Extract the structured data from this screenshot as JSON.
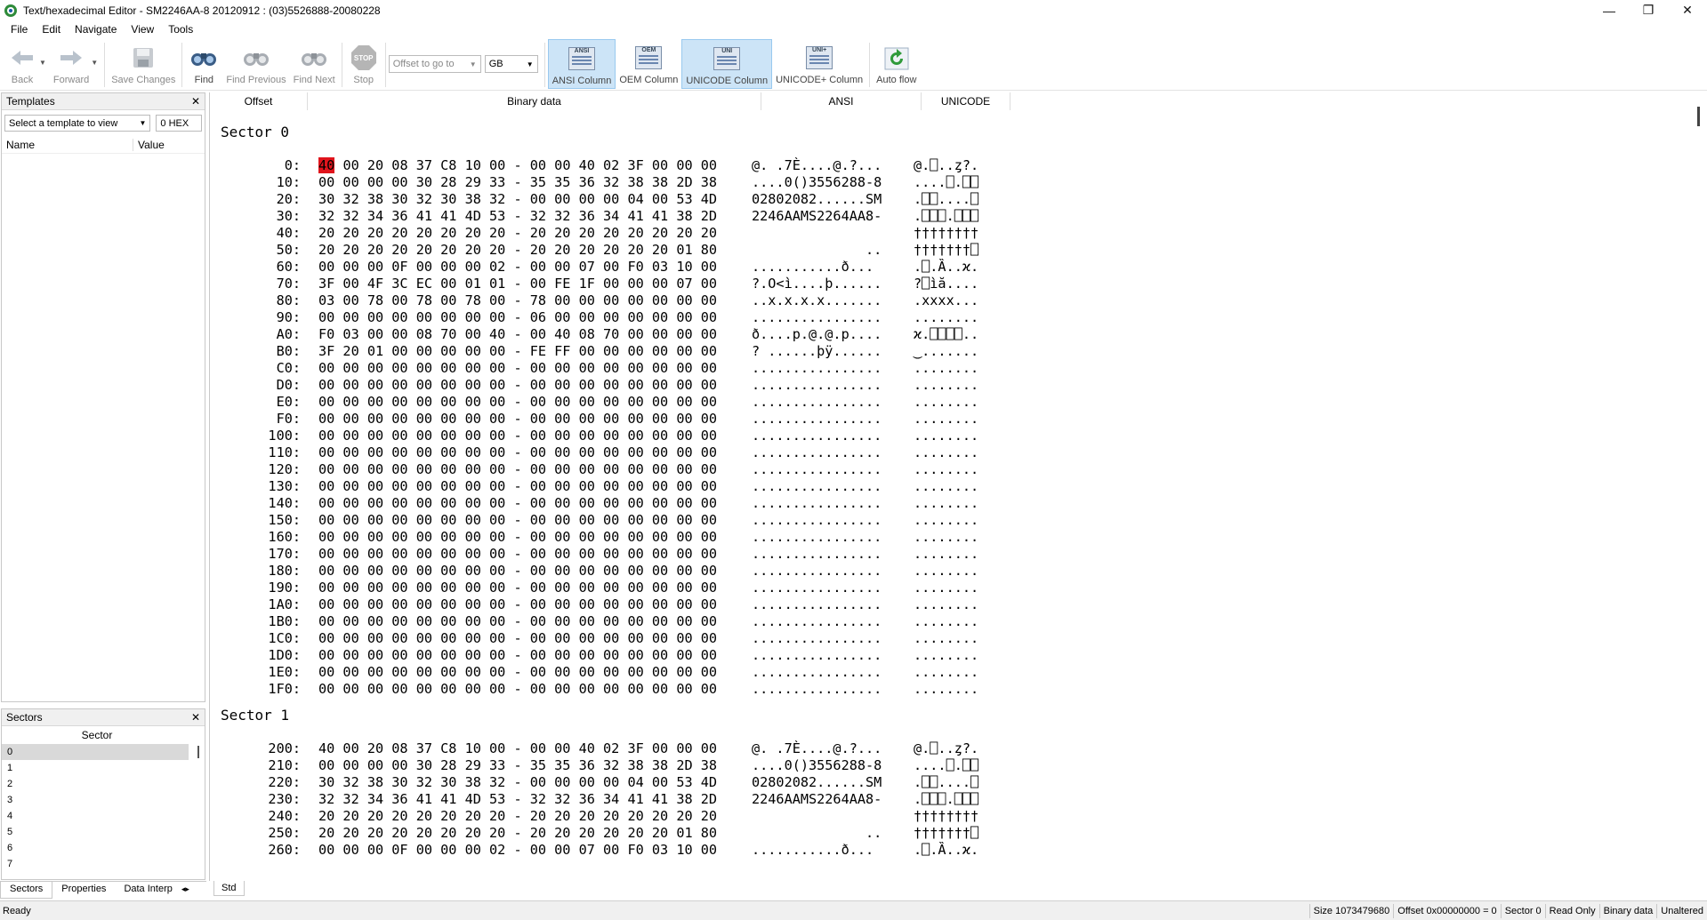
{
  "window": {
    "title": "Text/hexadecimal Editor - SM2246AA-8 20120912 : (03)5526888-20080228",
    "controls": [
      "—",
      "❐",
      "✕"
    ]
  },
  "menu": [
    "File",
    "Edit",
    "Navigate",
    "View",
    "Tools"
  ],
  "toolbar": {
    "back": "Back",
    "forward": "Forward",
    "save": "Save Changes",
    "find": "Find",
    "find_previous": "Find Previous",
    "find_next": "Find Next",
    "stop": "Stop",
    "stop_badge": "STOP",
    "offset_placeholder": "Offset to go to",
    "unit": "GB",
    "ansi_column": "ANSI Column",
    "ansi_badge": "ANSI",
    "oem_column": "OEM Column",
    "oem_badge": "OEM",
    "unicode_column": "UNICODE Column",
    "unicode_badge": "UNI",
    "unicode_plus_column": "UNICODE+ Column",
    "unicode_plus_badge": "UNI+",
    "auto_flow": "Auto flow"
  },
  "templates": {
    "title": "Templates",
    "select_placeholder": "Select a template to view",
    "offset_value": "0 HEX",
    "col_name": "Name",
    "col_value": "Value"
  },
  "sectors": {
    "title": "Sectors",
    "column": "Sector",
    "items": [
      "0",
      "1",
      "2",
      "3",
      "4",
      "5",
      "6",
      "7"
    ],
    "selected": "0"
  },
  "bottom_tabs": [
    "Sectors",
    "Properties",
    "Data Interp"
  ],
  "view_tab": "Std",
  "hex_header": {
    "offset": "Offset",
    "binary": "Binary data",
    "ansi": "ANSI",
    "unicode": "UNICODE"
  },
  "sector0": {
    "title": "Sector 0",
    "rows": [
      {
        "off": "0:",
        "bin": [
          "40",
          " 00 20 08 37 C8 10 00 - 00 00 40 02 3F 00 00 00"
        ],
        "ansi": "@. .7È....@.?...",
        "uni": "@.⎕..ȥ?."
      },
      {
        "off": "10:",
        "bin": [
          "",
          "00 00 00 00 30 28 29 33 - 35 35 36 32 38 38 2D 38"
        ],
        "ansi": "....0()3556288-8",
        "uni": "....⎕.⎕⎕"
      },
      {
        "off": "20:",
        "bin": [
          "",
          "30 32 38 30 32 30 38 32 - 00 00 00 00 04 00 53 4D"
        ],
        "ansi": "02802082......SM",
        "uni": ".⎕⎕....⎕"
      },
      {
        "off": "30:",
        "bin": [
          "",
          "32 32 34 36 41 41 4D 53 - 32 32 36 34 41 41 38 2D"
        ],
        "ansi": "2246AAMS2264AA8-",
        "uni": ".⎕⎕⎕.⎕⎕⎕"
      },
      {
        "off": "40:",
        "bin": [
          "",
          "20 20 20 20 20 20 20 20 - 20 20 20 20 20 20 20 20"
        ],
        "ansi": "                ",
        "uni": "††††††††"
      },
      {
        "off": "50:",
        "bin": [
          "",
          "20 20 20 20 20 20 20 20 - 20 20 20 20 20 20 01 80"
        ],
        "ansi": "              ..",
        "uni": "†††††††⎕"
      },
      {
        "off": "60:",
        "bin": [
          "",
          "00 00 00 0F 00 00 00 02 - 00 00 07 00 F0 03 10 00"
        ],
        "ansi": "...........ð...",
        "uni": ".⎕.Ȁ..ϰ."
      },
      {
        "off": "70:",
        "bin": [
          "",
          "3F 00 4F 3C EC 00 01 01 - 00 FE 1F 00 00 00 07 00"
        ],
        "ansi": "?.O<ì....þ......",
        "uni": "?⎕ìă...."
      },
      {
        "off": "80:",
        "bin": [
          "",
          "03 00 78 00 78 00 78 00 - 78 00 00 00 00 00 00 00"
        ],
        "ansi": "..x.x.x.x.......",
        "uni": ".xxxx..."
      },
      {
        "off": "90:",
        "bin": [
          "",
          "00 00 00 00 00 00 00 00 - 06 00 00 00 00 00 00 00"
        ],
        "ansi": "................",
        "uni": "........"
      },
      {
        "off": "A0:",
        "bin": [
          "",
          "F0 03 00 00 08 70 00 40 - 00 40 08 70 00 00 00 00"
        ],
        "ansi": "ð....p.@.@.p....",
        "uni": "ϰ.⎕⎕⎕⎕.."
      },
      {
        "off": "B0:",
        "bin": [
          "",
          "3F 20 01 00 00 00 00 00 - FE FF 00 00 00 00 00 00"
        ],
        "ansi": "? ......þÿ......",
        "uni": "‿.......",
        "note": ""
      },
      {
        "off": "C0:",
        "bin": [
          "",
          "00 00 00 00 00 00 00 00 - 00 00 00 00 00 00 00 00"
        ],
        "ansi": "................",
        "uni": "........"
      },
      {
        "off": "D0:",
        "bin": [
          "",
          "00 00 00 00 00 00 00 00 - 00 00 00 00 00 00 00 00"
        ],
        "ansi": "................",
        "uni": "........"
      },
      {
        "off": "E0:",
        "bin": [
          "",
          "00 00 00 00 00 00 00 00 - 00 00 00 00 00 00 00 00"
        ],
        "ansi": "................",
        "uni": "........"
      },
      {
        "off": "F0:",
        "bin": [
          "",
          "00 00 00 00 00 00 00 00 - 00 00 00 00 00 00 00 00"
        ],
        "ansi": "................",
        "uni": "........"
      },
      {
        "off": "100:",
        "bin": [
          "",
          "00 00 00 00 00 00 00 00 - 00 00 00 00 00 00 00 00"
        ],
        "ansi": "................",
        "uni": "........"
      },
      {
        "off": "110:",
        "bin": [
          "",
          "00 00 00 00 00 00 00 00 - 00 00 00 00 00 00 00 00"
        ],
        "ansi": "................",
        "uni": "........"
      },
      {
        "off": "120:",
        "bin": [
          "",
          "00 00 00 00 00 00 00 00 - 00 00 00 00 00 00 00 00"
        ],
        "ansi": "................",
        "uni": "........"
      },
      {
        "off": "130:",
        "bin": [
          "",
          "00 00 00 00 00 00 00 00 - 00 00 00 00 00 00 00 00"
        ],
        "ansi": "................",
        "uni": "........"
      },
      {
        "off": "140:",
        "bin": [
          "",
          "00 00 00 00 00 00 00 00 - 00 00 00 00 00 00 00 00"
        ],
        "ansi": "................",
        "uni": "........"
      },
      {
        "off": "150:",
        "bin": [
          "",
          "00 00 00 00 00 00 00 00 - 00 00 00 00 00 00 00 00"
        ],
        "ansi": "................",
        "uni": "........"
      },
      {
        "off": "160:",
        "bin": [
          "",
          "00 00 00 00 00 00 00 00 - 00 00 00 00 00 00 00 00"
        ],
        "ansi": "................",
        "uni": "........"
      },
      {
        "off": "170:",
        "bin": [
          "",
          "00 00 00 00 00 00 00 00 - 00 00 00 00 00 00 00 00"
        ],
        "ansi": "................",
        "uni": "........"
      },
      {
        "off": "180:",
        "bin": [
          "",
          "00 00 00 00 00 00 00 00 - 00 00 00 00 00 00 00 00"
        ],
        "ansi": "................",
        "uni": "........"
      },
      {
        "off": "190:",
        "bin": [
          "",
          "00 00 00 00 00 00 00 00 - 00 00 00 00 00 00 00 00"
        ],
        "ansi": "................",
        "uni": "........"
      },
      {
        "off": "1A0:",
        "bin": [
          "",
          "00 00 00 00 00 00 00 00 - 00 00 00 00 00 00 00 00"
        ],
        "ansi": "................",
        "uni": "........"
      },
      {
        "off": "1B0:",
        "bin": [
          "",
          "00 00 00 00 00 00 00 00 - 00 00 00 00 00 00 00 00"
        ],
        "ansi": "................",
        "uni": "........"
      },
      {
        "off": "1C0:",
        "bin": [
          "",
          "00 00 00 00 00 00 00 00 - 00 00 00 00 00 00 00 00"
        ],
        "ansi": "................",
        "uni": "........"
      },
      {
        "off": "1D0:",
        "bin": [
          "",
          "00 00 00 00 00 00 00 00 - 00 00 00 00 00 00 00 00"
        ],
        "ansi": "................",
        "uni": "........"
      },
      {
        "off": "1E0:",
        "bin": [
          "",
          "00 00 00 00 00 00 00 00 - 00 00 00 00 00 00 00 00"
        ],
        "ansi": "................",
        "uni": "........"
      },
      {
        "off": "1F0:",
        "bin": [
          "",
          "00 00 00 00 00 00 00 00 - 00 00 00 00 00 00 00 00"
        ],
        "ansi": "................",
        "uni": "........"
      }
    ]
  },
  "sector1": {
    "title": "Sector 1",
    "rows": [
      {
        "off": "200:",
        "bin": [
          "",
          "40 00 20 08 37 C8 10 00 - 00 00 40 02 3F 00 00 00"
        ],
        "ansi": "@. .7È....@.?...",
        "uni": "@.⎕..ȥ?."
      },
      {
        "off": "210:",
        "bin": [
          "",
          "00 00 00 00 30 28 29 33 - 35 35 36 32 38 38 2D 38"
        ],
        "ansi": "....0()3556288-8",
        "uni": "....⎕.⎕⎕"
      },
      {
        "off": "220:",
        "bin": [
          "",
          "30 32 38 30 32 30 38 32 - 00 00 00 00 04 00 53 4D"
        ],
        "ansi": "02802082......SM",
        "uni": ".⎕⎕....⎕"
      },
      {
        "off": "230:",
        "bin": [
          "",
          "32 32 34 36 41 41 4D 53 - 32 32 36 34 41 41 38 2D"
        ],
        "ansi": "2246AAMS2264AA8-",
        "uni": ".⎕⎕⎕.⎕⎕⎕"
      },
      {
        "off": "240:",
        "bin": [
          "",
          "20 20 20 20 20 20 20 20 - 20 20 20 20 20 20 20 20"
        ],
        "ansi": "                ",
        "uni": "††††††††"
      },
      {
        "off": "250:",
        "bin": [
          "",
          "20 20 20 20 20 20 20 20 - 20 20 20 20 20 20 01 80"
        ],
        "ansi": "              ..",
        "uni": "†††††††⎕"
      },
      {
        "off": "260:",
        "bin": [
          "",
          "00 00 00 0F 00 00 00 02 - 00 00 07 00 F0 03 10 00"
        ],
        "ansi": "...........ð...",
        "uni": ".⎕.Ȁ..ϰ."
      }
    ]
  },
  "status": {
    "ready": "Ready",
    "size": "Size 1073479680",
    "offset": "Offset 0x00000000 = 0",
    "sector": "Sector 0",
    "mode": "Read Only",
    "view": "Binary data",
    "state": "Unaltered"
  }
}
